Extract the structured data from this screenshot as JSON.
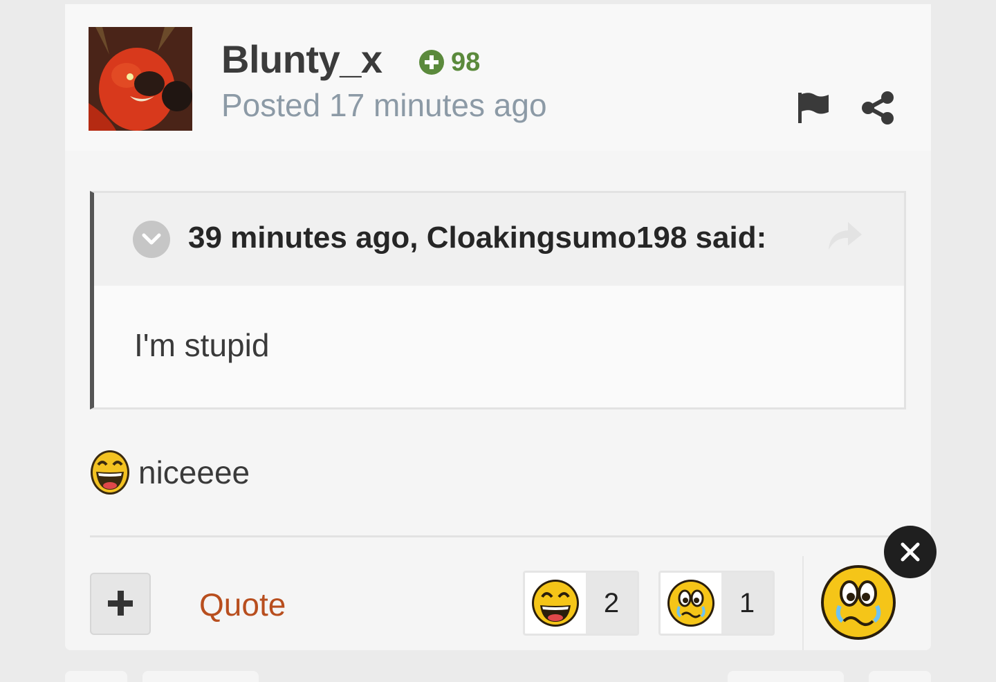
{
  "post": {
    "author": "Blunty_x",
    "reputation": "98",
    "posted": "Posted 17 minutes ago",
    "icons": {
      "reputation": "plus-circle-icon",
      "report": "flag-icon",
      "share": "share-icon"
    }
  },
  "quote": {
    "citation": "39 minutes ago, Cloakingsumo198 said:",
    "body": "I'm stupid",
    "icons": {
      "toggle": "chevron-down-icon",
      "jump": "share-arrow-icon"
    }
  },
  "content": {
    "emoji": "laughing-emoji-icon",
    "text": "niceeee"
  },
  "actions": {
    "multiquote_icon": "plus-icon",
    "quote_label": "Quote"
  },
  "reactions": [
    {
      "emoji": "laughing-emoji-icon",
      "count": "2"
    },
    {
      "emoji": "crying-emoji-icon",
      "count": "1"
    }
  ],
  "reaction_picker": {
    "selected_emoji": "crying-emoji-icon",
    "close_icon": "close-icon"
  },
  "colors": {
    "reputation": "#5b8a3c",
    "quote_link": "#b84e1e",
    "meta_text": "#8c9aa6"
  }
}
